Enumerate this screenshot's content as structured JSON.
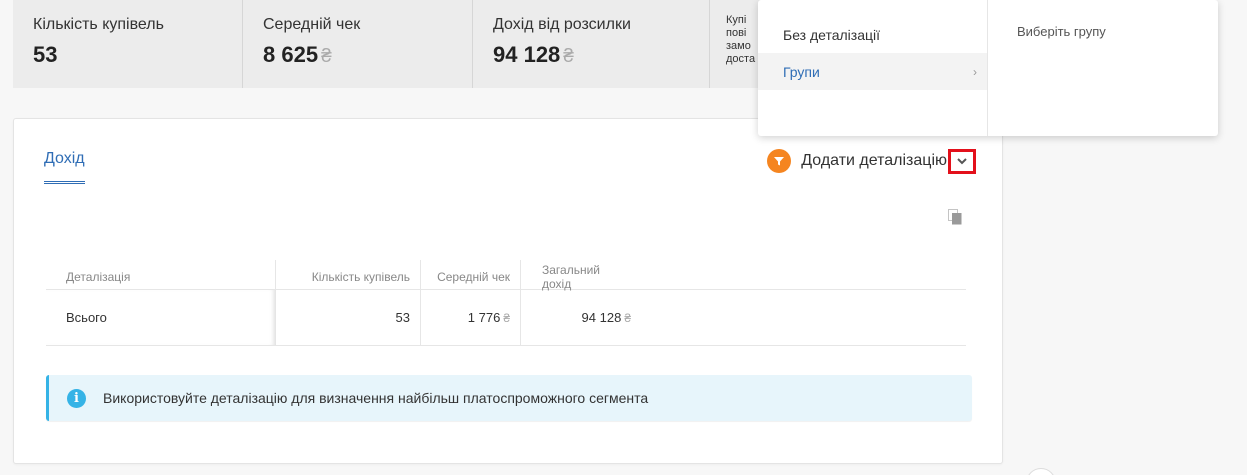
{
  "kpis": [
    {
      "label": "Кількість купівель",
      "value": "53"
    },
    {
      "label": "Середній чек",
      "value": "8 625",
      "currency": "₴"
    },
    {
      "label": "Дохід від розсилки",
      "value": "94 128",
      "currency": "₴"
    }
  ],
  "kpi_partial": {
    "lines": [
      "Купі",
      "пові",
      "замо",
      "доста"
    ]
  },
  "tabs": [
    {
      "label": "Дохід",
      "active": true
    }
  ],
  "add_detail": {
    "label": "Додати деталізацію"
  },
  "table": {
    "columns": [
      "Деталізація",
      "Кількість купівель",
      "Середній чек",
      "Загальний дохід"
    ],
    "rows": [
      {
        "name": "Всього",
        "purchases": "53",
        "avg_check": "1 776",
        "total": "94 128",
        "currency": "₴"
      }
    ]
  },
  "info_note": {
    "text": "Використовуйте деталізацію для визначення найбільш платоспроможного сегмента"
  },
  "dropdown": {
    "items": [
      {
        "label": "Без деталізації",
        "active": false
      },
      {
        "label": "Групи",
        "active": true
      }
    ],
    "right_placeholder": "Виберіть групу"
  },
  "colors": {
    "accent_blue": "#2f6db5",
    "orange": "#f58520",
    "info_blue": "#35b3e6",
    "highlight_red": "#e3101b"
  }
}
